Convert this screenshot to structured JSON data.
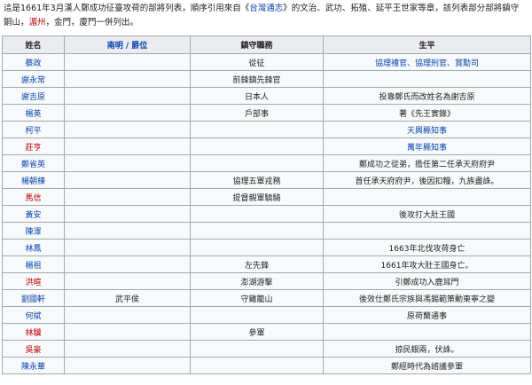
{
  "intro": {
    "text1": "這是1661年3月漢人鄭成功征臺攻荷的部將列表，順序引用來自《",
    "link1": "台灣通志",
    "text2": "》的文治、武功、拓殖、延平王世家等章，該列表部分部將鎮守",
    "text3": "銅山，",
    "link2": "湄州",
    "text4": "，金門，廈門一併列出。"
  },
  "headers": {
    "name": "姓名",
    "era": "南明 / 爵位",
    "post": "鎮守職務",
    "life": "生平"
  },
  "rows": [
    {
      "name": "蔡政",
      "name_color": "blue",
      "era": "",
      "post": "從征",
      "post_color": "black",
      "life": "協理禮官、協理刑官、賞勳司",
      "life_color": "blue"
    },
    {
      "name": "謝永常",
      "name_color": "blue",
      "era": "",
      "post": "前鋒鎮先鋒官",
      "post_color": "black",
      "life": "",
      "life_color": "black"
    },
    {
      "name": "謝吉原",
      "name_color": "blue",
      "era": "",
      "post": "日本人",
      "post_color": "black",
      "life": "投靠鄭氏而改姓名為謝吉原",
      "life_color": "black"
    },
    {
      "name": "楊英",
      "name_color": "blue",
      "era": "",
      "post": "戶部事",
      "post_color": "black",
      "life": "著《先王實錄》",
      "life_color": "black"
    },
    {
      "name": "柯平",
      "name_color": "blue",
      "era": "",
      "post": "",
      "post_color": "black",
      "life": "天興縣知事",
      "life_color": "blue"
    },
    {
      "name": "莊亨",
      "name_color": "red",
      "era": "",
      "post": "",
      "post_color": "black",
      "life": "萬年縣知事",
      "life_color": "blue"
    },
    {
      "name": "鄭省英",
      "name_color": "blue",
      "era": "",
      "post": "",
      "post_color": "black",
      "life": "鄭成功之從弟，擔任第二任承天府府尹",
      "life_color": "black"
    },
    {
      "name": "楊朝棟",
      "name_color": "blue",
      "era": "",
      "post": "協理五軍戎務",
      "post_color": "black",
      "life": "首任承天府府尹，後因扣糧，九族盡誅。",
      "life_color": "black"
    },
    {
      "name": "馬信",
      "name_color": "red",
      "era": "",
      "post": "提督親軍驍騎",
      "post_color": "black",
      "life": "",
      "life_color": "black"
    },
    {
      "name": "黃安",
      "name_color": "blue",
      "era": "",
      "post": "",
      "post_color": "black",
      "life": "後攻打大肚王國",
      "life_color": "black"
    },
    {
      "name": "陳澤",
      "name_color": "blue",
      "era": "",
      "post": "",
      "post_color": "black",
      "life": "",
      "life_color": "black"
    },
    {
      "name": "林鳳",
      "name_color": "blue",
      "era": "",
      "post": "",
      "post_color": "black",
      "life": "1663年北伐攻荷身亡",
      "life_color": "black"
    },
    {
      "name": "楊祖",
      "name_color": "blue",
      "era": "",
      "post": "左先鋒",
      "post_color": "black",
      "life": "1661年攻大肚王國身亡。",
      "life_color": "black"
    },
    {
      "name": "洪暄",
      "name_color": "red",
      "era": "",
      "post": "澎湖游擊",
      "post_color": "black",
      "life": "引鄭成功入鹿耳門",
      "life_color": "black"
    },
    {
      "name": "劉國軒",
      "name_color": "blue",
      "era": "武平侯",
      "post": "守雞籠山",
      "post_color": "black",
      "life": "後效仕鄭氏宗族與馮錫範策動東寧之變",
      "life_color": "black"
    },
    {
      "name": "何斌",
      "name_color": "blue",
      "era": "",
      "post": "",
      "post_color": "black",
      "life": "原荷蘭通事",
      "life_color": "black"
    },
    {
      "name": "林驥",
      "name_color": "red",
      "era": "",
      "post": "參軍",
      "post_color": "black",
      "life": "",
      "life_color": "black"
    },
    {
      "name": "吳豪",
      "name_color": "red",
      "era": "",
      "post": "",
      "post_color": "black",
      "life": "掠民銀兩，伏誅。",
      "life_color": "black"
    },
    {
      "name": "陳永華",
      "name_color": "blue",
      "era": "",
      "post": "",
      "post_color": "black",
      "life": "鄭經時代為諮議參軍",
      "life_color": "black"
    }
  ]
}
